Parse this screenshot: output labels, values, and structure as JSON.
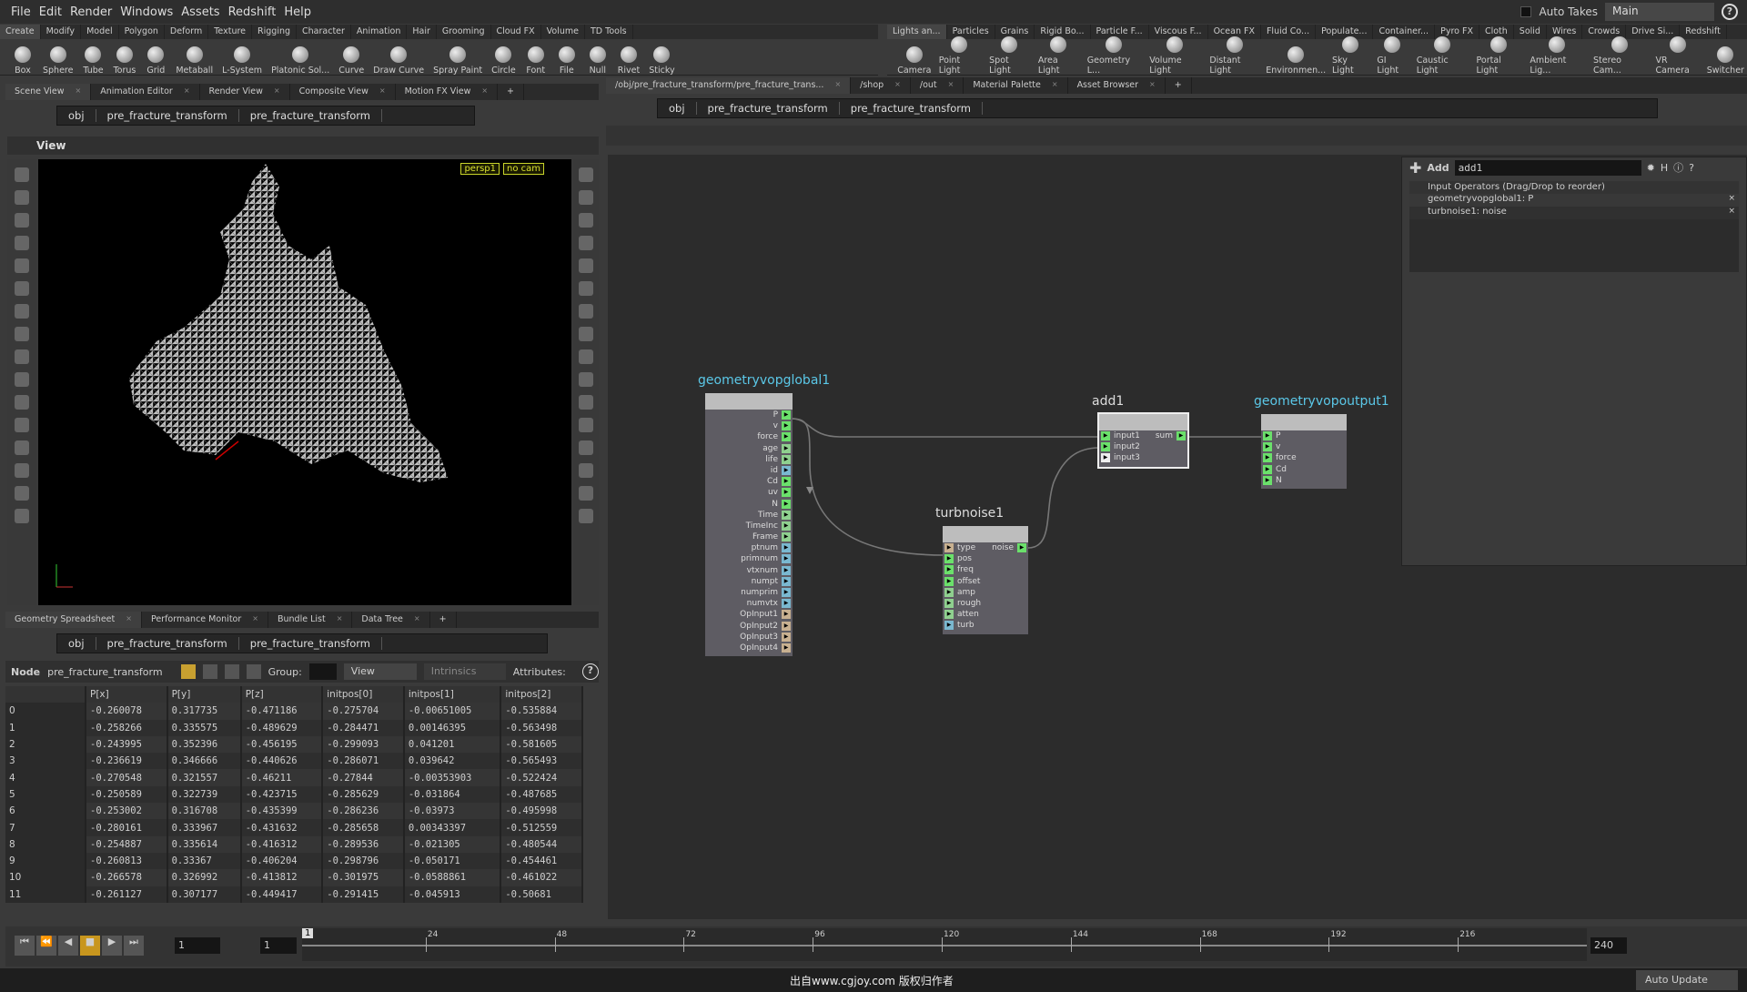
{
  "menu": [
    "File",
    "Edit",
    "Render",
    "Windows",
    "Assets",
    "Redshift",
    "Help"
  ],
  "takes": {
    "label": "Auto Takes",
    "current": "Main"
  },
  "shelf_left": {
    "tabs": [
      "Create",
      "Modify",
      "Model",
      "Polygon",
      "Deform",
      "Texture",
      "Rigging",
      "Character",
      "Animation",
      "Hair",
      "Grooming",
      "Cloud FX",
      "Volume",
      "TD Tools"
    ],
    "tools": [
      "Box",
      "Sphere",
      "Tube",
      "Torus",
      "Grid",
      "Metaball",
      "L-System",
      "Platonic Sol...",
      "Curve",
      "Draw Curve",
      "Spray Paint",
      "Circle",
      "Font",
      "File",
      "Null",
      "Rivet",
      "Sticky"
    ]
  },
  "shelf_right": {
    "tabs": [
      "Lights an...",
      "Particles",
      "Grains",
      "Rigid Bo...",
      "Particle F...",
      "Viscous F...",
      "Ocean FX",
      "Fluid Co...",
      "Populate...",
      "Container...",
      "Pyro FX",
      "Cloth",
      "Solid",
      "Wires",
      "Crowds",
      "Drive Si...",
      "Redshift"
    ],
    "tools": [
      "Camera",
      "Point Light",
      "Spot Light",
      "Area Light",
      "Geometry L...",
      "Volume Light",
      "Distant Light",
      "Environmen...",
      "Sky Light",
      "GI Light",
      "Caustic Light",
      "Portal Light",
      "Ambient Lig...",
      "Stereo Cam...",
      "VR Camera",
      "Switcher"
    ]
  },
  "scene_pane": {
    "tabs": [
      "Scene View",
      "Animation Editor",
      "Render View",
      "Composite View",
      "Motion FX View"
    ],
    "path": [
      "obj",
      "pre_fracture_transform",
      "pre_fracture_transform"
    ],
    "view_label": "View",
    "camera": "persp1",
    "cam_menu": "no cam"
  },
  "sheet_pane": {
    "tabs": [
      "Geometry Spreadsheet",
      "Performance Monitor",
      "Bundle List",
      "Data Tree"
    ],
    "path": [
      "obj",
      "pre_fracture_transform",
      "pre_fracture_transform"
    ],
    "node_label": "Node",
    "node_name": "pre_fracture_transform",
    "group_label": "Group:",
    "view_menu": "View",
    "intrinsics_menu": "Intrinsics",
    "attributes_label": "Attributes:",
    "columns": [
      "",
      "P[x]",
      "P[y]",
      "P[z]",
      "initpos[0]",
      "initpos[1]",
      "initpos[2]"
    ],
    "rows": [
      [
        "0",
        "-0.260078",
        "0.317735",
        "-0.471186",
        "-0.275704",
        "-0.00651005",
        "-0.535884"
      ],
      [
        "1",
        "-0.258266",
        "0.335575",
        "-0.489629",
        "-0.284471",
        "0.00146395",
        "-0.563498"
      ],
      [
        "2",
        "-0.243995",
        "0.352396",
        "-0.456195",
        "-0.299093",
        "0.041201",
        "-0.581605"
      ],
      [
        "3",
        "-0.236619",
        "0.346666",
        "-0.440626",
        "-0.286071",
        "0.039642",
        "-0.565493"
      ],
      [
        "4",
        "-0.270548",
        "0.321557",
        "-0.46211",
        "-0.27844",
        "-0.00353903",
        "-0.522424"
      ],
      [
        "5",
        "-0.250589",
        "0.322739",
        "-0.423715",
        "-0.285629",
        "-0.031864",
        "-0.487685"
      ],
      [
        "6",
        "-0.253002",
        "0.316708",
        "-0.435399",
        "-0.286236",
        "-0.03973",
        "-0.495998"
      ],
      [
        "7",
        "-0.280161",
        "0.333967",
        "-0.431632",
        "-0.285658",
        "0.00343397",
        "-0.512559"
      ],
      [
        "8",
        "-0.254887",
        "0.335614",
        "-0.416312",
        "-0.289536",
        "-0.021305",
        "-0.480544"
      ],
      [
        "9",
        "-0.260813",
        "0.33367",
        "-0.406204",
        "-0.298796",
        "-0.050171",
        "-0.454461"
      ],
      [
        "10",
        "-0.266578",
        "0.326992",
        "-0.413812",
        "-0.301975",
        "-0.0588861",
        "-0.461022"
      ],
      [
        "11",
        "-0.261127",
        "0.307177",
        "-0.449417",
        "-0.291415",
        "-0.045913",
        "-0.50681"
      ]
    ]
  },
  "network_pane": {
    "tabs": [
      "/obj/pre_fracture_transform/pre_fracture_trans...",
      "/shop",
      "/out",
      "Material Palette",
      "Asset Browser"
    ],
    "path": [
      "obj",
      "pre_fracture_transform",
      "pre_fracture_transform"
    ]
  },
  "nodes": {
    "global": {
      "name": "geometryvopglobal1",
      "outputs": [
        "P",
        "v",
        "force",
        "age",
        "life",
        "id",
        "Cd",
        "uv",
        "N",
        "Time",
        "TimeInc",
        "Frame",
        "ptnum",
        "primnum",
        "vtxnum",
        "numpt",
        "numprim",
        "numvtx",
        "OpInput1",
        "OpInput2",
        "OpInput3",
        "OpInput4"
      ]
    },
    "turb": {
      "name": "turbnoise1",
      "inputs": [
        "type",
        "pos",
        "freq",
        "offset",
        "amp",
        "rough",
        "atten",
        "turb"
      ],
      "output": "noise"
    },
    "add": {
      "name": "add1",
      "inputs": [
        "input1",
        "input2",
        "input3"
      ],
      "output": "sum"
    },
    "out": {
      "name": "geometryvopoutput1",
      "inputs": [
        "P",
        "v",
        "force",
        "Cd",
        "N"
      ]
    }
  },
  "params": {
    "type_label": "Add",
    "name": "add1",
    "list_header": "Input Operators (Drag/Drop to reorder)",
    "inputs": [
      "geometryvopglobal1: P",
      "turbnoise1: noise"
    ]
  },
  "timeline": {
    "current_frame": "1",
    "start": "1",
    "end": "240",
    "ticks": [
      "24",
      "48",
      "72",
      "96",
      "120",
      "144",
      "168",
      "192",
      "216"
    ],
    "marker": "1"
  },
  "status": {
    "watermark": "出自www.cgjoy.com 版权归作者",
    "update_mode": "Auto Update"
  },
  "colors": {
    "float_port": "#8fd08f",
    "vector_port": "#6be06b",
    "int_port": "#7ab8d0",
    "string_port": "#c8b090",
    "node_label": "#5bc8e8"
  }
}
